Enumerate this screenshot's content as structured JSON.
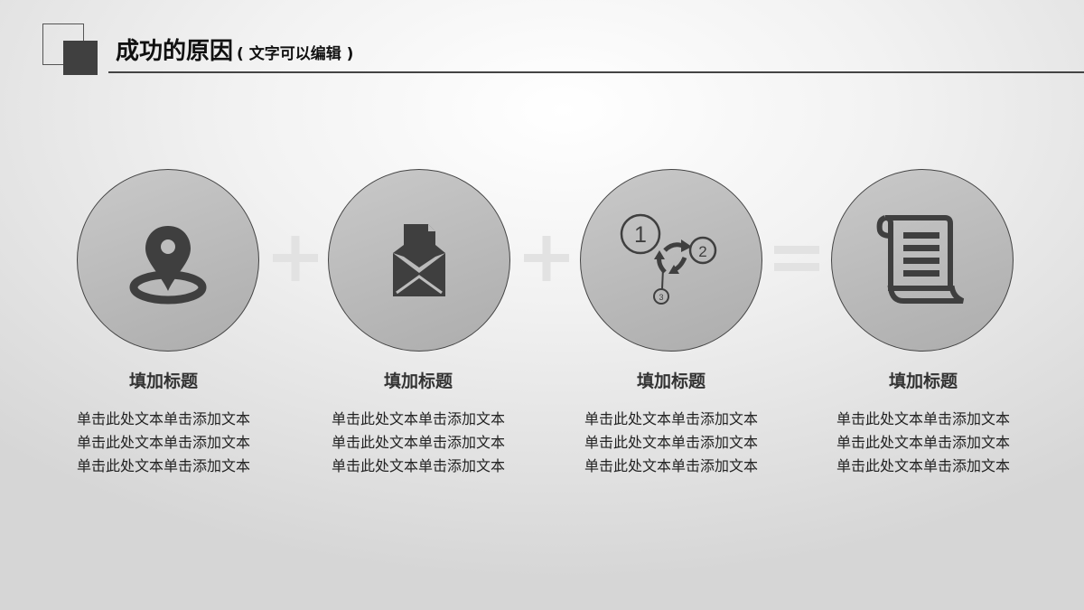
{
  "header": {
    "title": "成功的原因",
    "subtitle": "( 文字可以编辑 )"
  },
  "items": [
    {
      "icon": "map-pin-icon",
      "heading": "填加标题",
      "lines": [
        "单击此处文本单击添加文本",
        "单击此处文本单击添加文本",
        "单击此处文本单击添加文本"
      ]
    },
    {
      "icon": "envelope-icon",
      "heading": "填加标题",
      "lines": [
        "单击此处文本单击添加文本",
        "单击此处文本单击添加文本",
        "单击此处文本单击添加文本"
      ]
    },
    {
      "icon": "process-cycle-icon",
      "heading": "填加标题",
      "lines": [
        "单击此处文本单击添加文本",
        "单击此处文本单击添加文本",
        "单击此处文本单击添加文本"
      ]
    },
    {
      "icon": "scroll-document-icon",
      "heading": "填加标题",
      "lines": [
        "单击此处文本单击添加文本",
        "单击此处文本单击添加文本",
        "单击此处文本单击添加文本"
      ]
    }
  ],
  "cycle_icon_numbers": [
    "1",
    "2",
    "3"
  ],
  "operators": [
    "plus",
    "plus",
    "equals"
  ],
  "colors": {
    "icon": "#3f3f3f",
    "circle_fill": "#bdbdbd",
    "operator": "#e2e2e2",
    "rule": "#444444"
  }
}
